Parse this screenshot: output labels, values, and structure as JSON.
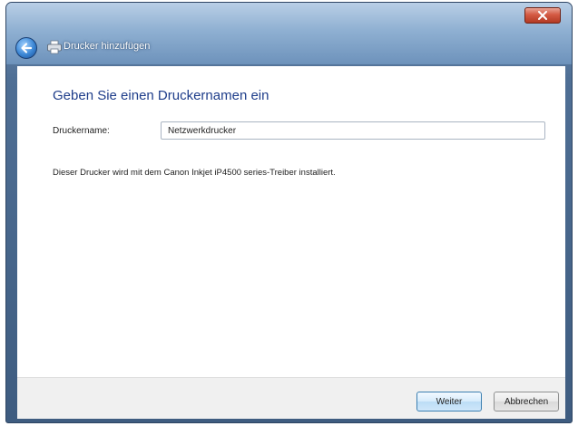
{
  "window": {
    "title": "Drucker hinzufügen"
  },
  "icons": {
    "close": "close-icon",
    "back": "back-arrow-icon",
    "printer": "printer-icon"
  },
  "main": {
    "heading": "Geben Sie einen Druckernamen ein",
    "printer_name_label": "Druckername:",
    "printer_name_value": "Netzwerkdrucker",
    "info_text": "Dieser Drucker wird mit dem Canon Inkjet iP4500 series-Treiber installiert."
  },
  "footer": {
    "next_label": "Weiter",
    "cancel_label": "Abbrechen"
  },
  "colors": {
    "heading": "#1e3d8a",
    "titlebar": "#8fb0d2",
    "close_button": "#d45a43",
    "footer_bg": "#f0f0f0"
  }
}
